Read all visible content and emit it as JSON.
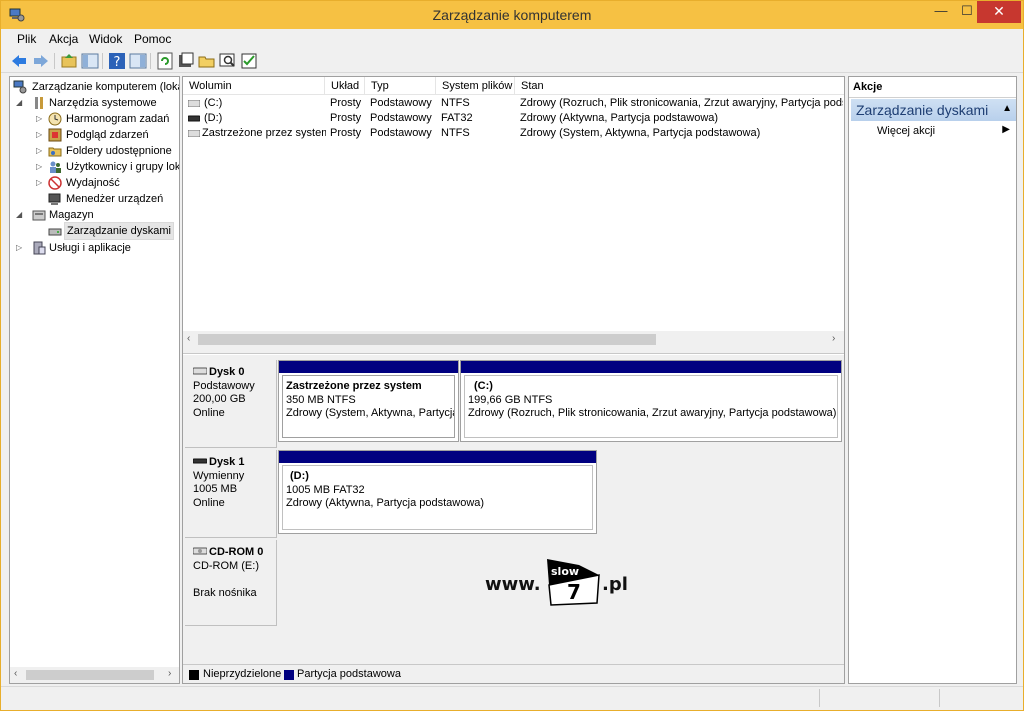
{
  "window": {
    "title": "Zarządzanie komputerem",
    "minimize": "—",
    "maximize": "☐",
    "close": "✕"
  },
  "menu": [
    "Plik",
    "Akcja",
    "Widok",
    "Pomoc"
  ],
  "tree": {
    "root": "Zarządzanie komputerem (lokalny)",
    "items": [
      {
        "label": "Narzędzia systemowe"
      },
      {
        "label": "Harmonogram zadań"
      },
      {
        "label": "Podgląd zdarzeń"
      },
      {
        "label": "Foldery udostępnione"
      },
      {
        "label": "Użytkownicy i grupy lokalne"
      },
      {
        "label": "Wydajność"
      },
      {
        "label": "Menedżer urządzeń"
      },
      {
        "label": "Magazyn"
      },
      {
        "label": "Zarządzanie dyskami"
      },
      {
        "label": "Usługi i aplikacje"
      }
    ]
  },
  "volumes": {
    "columns": [
      "Wolumin",
      "Układ",
      "Typ",
      "System plików",
      "Stan"
    ],
    "rows": [
      {
        "volume": "(C:)",
        "layout": "Prosty",
        "type": "Podstawowy",
        "fs": "NTFS",
        "status": "Zdrowy (Rozruch, Plik stronicowania, Zrzut awaryjny, Partycja podstawowa)"
      },
      {
        "volume": "(D:)",
        "layout": "Prosty",
        "type": "Podstawowy",
        "fs": "FAT32",
        "status": "Zdrowy (Aktywna, Partycja podstawowa)"
      },
      {
        "volume": "Zastrzeżone przez system",
        "layout": "Prosty",
        "type": "Podstawowy",
        "fs": "NTFS",
        "status": "Zdrowy (System, Aktywna, Partycja podstawowa)"
      }
    ]
  },
  "disks": [
    {
      "name": "Dysk 0",
      "kind": "Podstawowy",
      "size": "200,00 GB",
      "state": "Online",
      "partitions": [
        {
          "name": "Zastrzeżone przez system",
          "size": "350 MB NTFS",
          "status": "Zdrowy (System, Aktywna, Partycja podstawowa)"
        },
        {
          "name": "(C:)",
          "size": "199,66 GB NTFS",
          "status": "Zdrowy (Rozruch, Plik stronicowania, Zrzut awaryjny, Partycja podstawowa)"
        }
      ]
    },
    {
      "name": "Dysk 1",
      "kind": "Wymienny",
      "size": "1005 MB",
      "state": "Online",
      "partitions": [
        {
          "name": "(D:)",
          "size": "1005 MB FAT32",
          "status": "Zdrowy (Aktywna, Partycja podstawowa)"
        }
      ]
    },
    {
      "name": "CD-ROM 0",
      "kind": "CD-ROM (E:)",
      "size": "",
      "state": "Brak nośnika",
      "partitions": []
    }
  ],
  "legend": [
    {
      "label": "Nieprzydzielone",
      "color": "#000000"
    },
    {
      "label": "Partycja podstawowa",
      "color": "#000080"
    }
  ],
  "actions": {
    "header": "Akcje",
    "section": "Zarządzanie dyskami",
    "items": [
      "Więcej akcji"
    ]
  },
  "watermark": {
    "prefix": "www.",
    "badge_top": "slow",
    "badge_bottom": "7",
    "suffix": ".pl"
  },
  "colors": {
    "titlebar": "#f6c143",
    "close_button": "#c7372f",
    "primary_partition": "#000080",
    "unallocated": "#000000"
  }
}
